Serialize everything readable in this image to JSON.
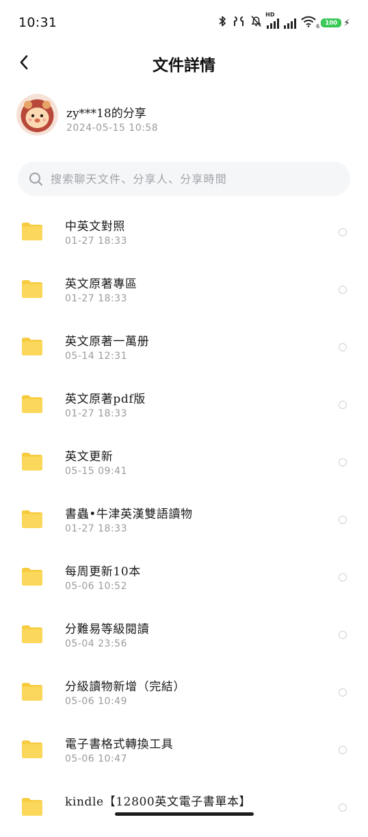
{
  "status_bar": {
    "time": "10:31",
    "signal_hd": "HD",
    "wifi_sub": "6",
    "battery": "100",
    "battery_color": "#3ccb5a"
  },
  "header": {
    "title": "文件詳情",
    "back_icon": "chevron-left-icon"
  },
  "sharer": {
    "name": "zy***18的分享",
    "time": "2024-05-15  10:58"
  },
  "search": {
    "placeholder": "搜索聊天文件、分享人、分享時間",
    "value": ""
  },
  "files": [
    {
      "name": "中英文對照",
      "time": "01-27  18:33"
    },
    {
      "name": "英文原著專區",
      "time": "01-27  18:33"
    },
    {
      "name": "英文原著一萬册",
      "time": "05-14  12:31"
    },
    {
      "name": "英文原著pdf版",
      "time": "01-27  18:33"
    },
    {
      "name": "英文更新",
      "time": "05-15  09:41"
    },
    {
      "name": "書蟲•牛津英漢雙語讀物",
      "time": "01-27  18:33"
    },
    {
      "name": "每周更新10本",
      "time": "05-06  10:52"
    },
    {
      "name": "分難易等級閱讀",
      "time": "05-04  23:56"
    },
    {
      "name": "分級讀物新增（完結）",
      "time": "05-06  10:49"
    },
    {
      "name": "電子書格式轉換工具",
      "time": "05-06  10:47"
    },
    {
      "name": "kindle【12800英文電子書單本】",
      "time": ""
    }
  ],
  "colors": {
    "folder": "#fbd85b",
    "folder_tab": "#f7cb3e",
    "secondary_text": "#9b9b9b",
    "search_bg": "#f5f6f8"
  }
}
